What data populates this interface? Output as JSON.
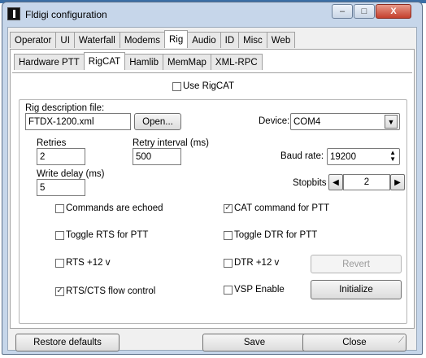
{
  "window": {
    "title": "Fldigi configuration",
    "minimize_glyph": "–",
    "maximize_glyph": "□",
    "close_glyph": "X"
  },
  "main_tabs": [
    {
      "label": "Operator",
      "active": false
    },
    {
      "label": "UI",
      "active": false
    },
    {
      "label": "Waterfall",
      "active": false
    },
    {
      "label": "Modems",
      "active": false
    },
    {
      "label": "Rig",
      "active": true
    },
    {
      "label": "Audio",
      "active": false
    },
    {
      "label": "ID",
      "active": false
    },
    {
      "label": "Misc",
      "active": false
    },
    {
      "label": "Web",
      "active": false
    }
  ],
  "sub_tabs": [
    {
      "label": "Hardware PTT",
      "active": false
    },
    {
      "label": "RigCAT",
      "active": true
    },
    {
      "label": "Hamlib",
      "active": false
    },
    {
      "label": "MemMap",
      "active": false
    },
    {
      "label": "XML-RPC",
      "active": false
    }
  ],
  "rigcat": {
    "use_rigcat": {
      "label": "Use RigCAT",
      "checked": false
    },
    "rig_desc_label": "Rig description file:",
    "rig_desc_value": "FTDX-1200.xml",
    "open_label": "Open...",
    "device_label": "Device:",
    "device_value": "COM4",
    "retries_label": "Retries",
    "retries_value": "2",
    "retry_interval_label": "Retry interval (ms)",
    "retry_interval_value": "500",
    "write_delay_label": "Write delay (ms)",
    "write_delay_value": "5",
    "baud_label": "Baud rate:",
    "baud_value": "19200",
    "stopbits_label": "Stopbits",
    "stopbits_value": "2",
    "checks": {
      "echoed": {
        "label": "Commands are echoed",
        "checked": false
      },
      "cat_ptt": {
        "label": "CAT command for PTT",
        "checked": true
      },
      "rts_ptt": {
        "label": "Toggle RTS for PTT",
        "checked": false
      },
      "dtr_ptt": {
        "label": "Toggle DTR for PTT",
        "checked": false
      },
      "rts_12": {
        "label": "RTS +12 v",
        "checked": false
      },
      "dtr_12": {
        "label": "DTR +12 v",
        "checked": false
      },
      "rtscts": {
        "label": "RTS/CTS flow control",
        "checked": true
      },
      "vsp": {
        "label": "VSP Enable",
        "checked": false
      }
    },
    "revert_label": "Revert",
    "initialize_label": "Initialize"
  },
  "footer": {
    "restore_label": "Restore defaults",
    "save_label": "Save",
    "close_label": "Close"
  }
}
